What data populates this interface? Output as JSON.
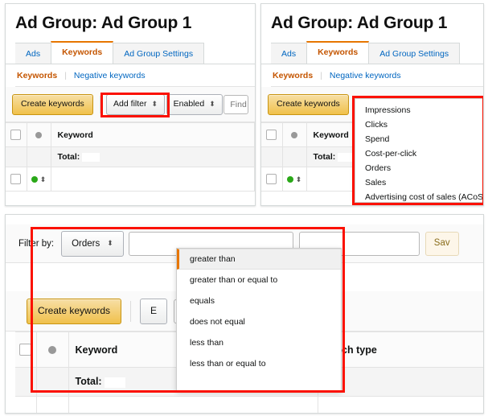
{
  "theme": {
    "accent_orange": "#e77600",
    "link_blue": "#0066c0",
    "active_tab_text": "#c45500",
    "primary_button_gold": "#f0c14b",
    "highlight_red": "#fb1100",
    "status_green": "#2aa818"
  },
  "panel_top_left": {
    "title": "Ad Group: Ad Group 1",
    "tabs": [
      {
        "label": "Ads",
        "active": false
      },
      {
        "label": "Keywords",
        "active": true
      },
      {
        "label": "Ad Group Settings",
        "active": false
      }
    ],
    "subnav": {
      "current": "Keywords",
      "separator": "|",
      "link": "Negative keywords"
    },
    "toolbar": {
      "create_button": "Create keywords",
      "add_filter_button": "Add filter",
      "state_select": "Enabled",
      "search_placeholder": "Find a k",
      "stepper_glyph": "⬍"
    },
    "table": {
      "header": {
        "keyword": "Keyword"
      },
      "total_row": {
        "label": "Total:"
      }
    }
  },
  "panel_top_right": {
    "title": "Ad Group: Ad Group 1",
    "tabs": [
      {
        "label": "Ads",
        "active": false
      },
      {
        "label": "Keywords",
        "active": true
      },
      {
        "label": "Ad Group Settings",
        "active": false
      }
    ],
    "subnav": {
      "current": "Keywords",
      "separator": "|",
      "link": "Negative keywords"
    },
    "toolbar": {
      "create_button": "Create keywords"
    },
    "table": {
      "header": {
        "keyword": "Keyword"
      },
      "total_row": {
        "label": "Total:"
      }
    },
    "metrics_menu": [
      "Impressions",
      "Clicks",
      "Spend",
      "Cost-per-click",
      "Orders",
      "Sales",
      "Advertising cost of sales (ACoS)"
    ]
  },
  "panel_bottom": {
    "filter_bar": {
      "label": "Filter by:",
      "field_select": "Orders",
      "value_input": "",
      "save_button": "Sav",
      "stepper_glyph": "⬍"
    },
    "toolbar": {
      "create_button": "Create keywords",
      "state_select": "E"
    },
    "table": {
      "header": {
        "keyword": "Keyword",
        "match_type": "Match type"
      },
      "total_row": {
        "label": "Total:"
      }
    },
    "operator_menu": {
      "selected": "greater than",
      "options": [
        "greater than",
        "greater than or equal to",
        "equals",
        "does not equal",
        "less than",
        "less than or equal to"
      ]
    }
  }
}
